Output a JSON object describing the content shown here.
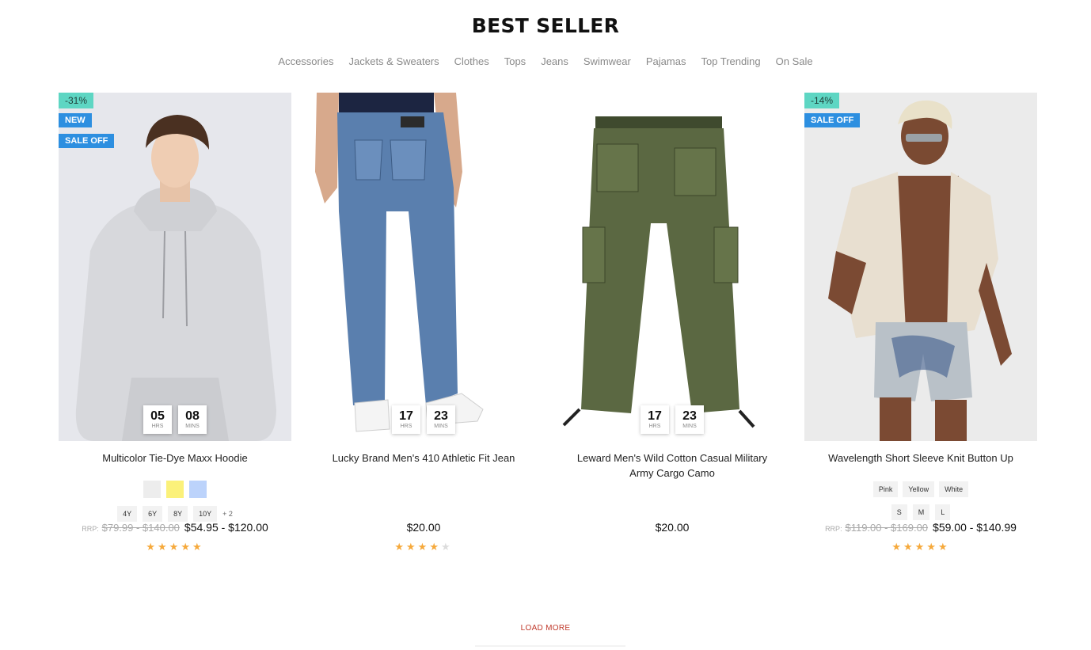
{
  "section": {
    "title": "BEST SELLER",
    "tabs": [
      "Accessories",
      "Jackets & Sweaters",
      "Clothes",
      "Tops",
      "Jeans",
      "Swimwear",
      "Pajamas",
      "Top Trending",
      "On Sale"
    ]
  },
  "products": [
    {
      "title": "Multicolor Tie-Dye Maxx Hoodie",
      "discount": "-31%",
      "badge_new": "NEW",
      "badge_sale": "SALE OFF",
      "countdown": {
        "hrs": "05",
        "mins": "08",
        "hrs_label": "HRS",
        "mins_label": "MINS"
      },
      "swatch_colors": [
        "#ededed",
        "#fbf17a",
        "#bcd3fb"
      ],
      "sizes": [
        "4Y",
        "6Y",
        "8Y",
        "10Y"
      ],
      "sizes_more": "+ 2",
      "rrp_label": "RRP:",
      "old_price": "$79.99 - $140.00",
      "price": "$54.95 - $120.00",
      "rating": 5
    },
    {
      "title": "Lucky Brand Men's 410 Athletic Fit Jean",
      "countdown": {
        "hrs": "17",
        "mins": "23",
        "hrs_label": "HRS",
        "mins_label": "MINS"
      },
      "price": "$20.00",
      "rating": 4
    },
    {
      "title": "Leward Men's Wild Cotton Casual Military Army Cargo Camo",
      "countdown": {
        "hrs": "17",
        "mins": "23",
        "hrs_label": "HRS",
        "mins_label": "MINS"
      },
      "price": "$20.00"
    },
    {
      "title": "Wavelength Short Sleeve Knit Button Up",
      "discount": "-14%",
      "badge_sale": "SALE OFF",
      "colors": [
        "Pink",
        "Yellow",
        "White"
      ],
      "sizes": [
        "S",
        "M",
        "L"
      ],
      "rrp_label": "RRP:",
      "old_price": "$119.00 - $169.00",
      "price": "$59.00 - $140.99",
      "rating": 5
    }
  ],
  "load_more": "LOAD MORE",
  "colors": {
    "discount_badge": "#5ed6c3",
    "blue_badge": "#2d8fe0",
    "star": "#f6a93b",
    "load_more": "#c0392b"
  }
}
